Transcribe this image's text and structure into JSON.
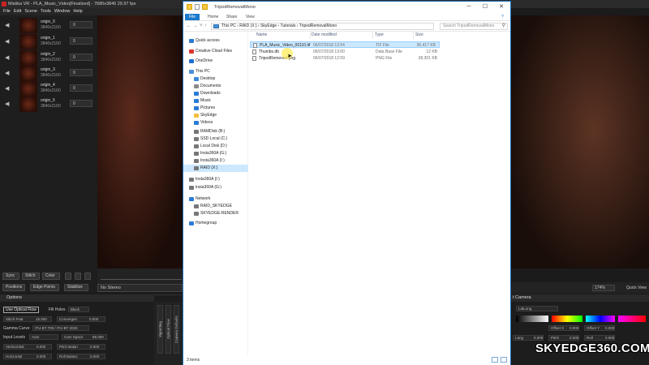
{
  "app": {
    "title": "Mistika VR - PLA_Music_Video[Finalized] - 7680x3840 29.97 fps",
    "menu": [
      "File",
      "Edit",
      "Scene",
      "Tools",
      "Window",
      "Help"
    ]
  },
  "clips": [
    {
      "name": "origin_0",
      "res": "3840x2160",
      "value": "0"
    },
    {
      "name": "origin_1",
      "res": "3840x2160",
      "value": "0"
    },
    {
      "name": "origin_2",
      "res": "3840x2160",
      "value": "0"
    },
    {
      "name": "origin_3",
      "res": "3840x2160",
      "value": "0"
    },
    {
      "name": "origin_4",
      "res": "3840x2160",
      "value": "0"
    },
    {
      "name": "origin_5",
      "res": "3840x2160",
      "value": "0"
    }
  ],
  "toolbar": {
    "sync": "Sync",
    "stitch": "Stitch",
    "color": "Color",
    "positions": "Positions",
    "edge_points": "Edge Points",
    "stabilize": "Stabilize",
    "no_stereo": "No Stereo",
    "zoom": "174%",
    "quick_view": "Quick View"
  },
  "options": {
    "title": "Options",
    "use_optical_flow": "Use Optical Flow",
    "fill_holes_label": "Fill Holes",
    "fill_holes_value": "Black",
    "stitch_feather_label": "Stitch Feat",
    "stitch_feather_value": "15.000",
    "convergence_label": "Convergen",
    "convergence_value": "0.000",
    "gamma_label": "Gamma Curve",
    "gamma_value": "ITU-BT 709 / ITU-BT 2020",
    "input_levels_label": "Input Levels",
    "input_levels_value": "Auto",
    "cam_spacing_label": "Cam Spacir",
    "cam_spacing_value": "65.000",
    "vertical_bal_label": "Vertical Bal",
    "vertical_bal_value": "0.000",
    "pitch_balance_label": "Pitch Balan",
    "pitch_balance_value": "0.000",
    "horizontal_label": "Horizontal",
    "horizontal_value": "0.000",
    "roll_balance_label": "Roll Balanc",
    "roll_balance_value": "0.000",
    "vtabs": [
      "Vignetting",
      "Optical Flow",
      "Camera Defaults"
    ]
  },
  "camera": {
    "title": "t Camera",
    "projection": "LatLong",
    "fields": [
      {
        "label": "Lang",
        "value": "0.000"
      },
      {
        "label": "Pitch",
        "value": "0.000"
      },
      {
        "label": "Roll",
        "value": "0.000"
      },
      {
        "label": "Offset X",
        "value": "0.000"
      },
      {
        "label": "Offset Y",
        "value": "0.000"
      }
    ]
  },
  "watermark": "SKYEDGE360.COM",
  "explorer": {
    "title": "TripodRemovalMono",
    "ribbon": {
      "file": "File",
      "home": "Home",
      "share": "Share",
      "view": "View"
    },
    "path": [
      "This PC",
      "RAID (X:)",
      "SkyEdge",
      "Tutorials",
      "TripodRemovalMono"
    ],
    "search_placeholder": "Search TripodRemovalMono",
    "nav": [
      {
        "label": "Quick access",
        "color": "#2b7bd6",
        "indent": 0
      },
      {
        "label": "Creative Cloud Files",
        "color": "#d9362b",
        "indent": 0
      },
      {
        "label": "OneDrive",
        "color": "#1c6fd0",
        "indent": 0
      },
      {
        "label": "This PC",
        "color": "#4a90d9",
        "indent": 0
      },
      {
        "label": "Desktop",
        "color": "#3b8ad8",
        "indent": 1
      },
      {
        "label": "Documents",
        "color": "#8a8a8a",
        "indent": 1
      },
      {
        "label": "Downloads",
        "color": "#2b7bd6",
        "indent": 1
      },
      {
        "label": "Music",
        "color": "#2b7bd6",
        "indent": 1
      },
      {
        "label": "Pictures",
        "color": "#2b7bd6",
        "indent": 1
      },
      {
        "label": "SkyEdge",
        "color": "#f0c040",
        "indent": 1
      },
      {
        "label": "Videos",
        "color": "#2b7bd6",
        "indent": 1
      },
      {
        "label": "RAMDisk (B:)",
        "color": "#777",
        "indent": 1
      },
      {
        "label": "SSD Local (C:)",
        "color": "#777",
        "indent": 1
      },
      {
        "label": "Local Disk (D:)",
        "color": "#777",
        "indent": 1
      },
      {
        "label": "Insta360A (G:)",
        "color": "#777",
        "indent": 1
      },
      {
        "label": "Insta360A (I:)",
        "color": "#777",
        "indent": 1
      },
      {
        "label": "RAID (X:)",
        "color": "#777",
        "indent": 1
      },
      {
        "label": "Insta360A (I:)",
        "color": "#777",
        "indent": 0
      },
      {
        "label": "insta360A (G:)",
        "color": "#777",
        "indent": 0
      },
      {
        "label": "Network",
        "color": "#2b7bd6",
        "indent": 0
      },
      {
        "label": "RAID_SKYEDGE",
        "color": "#777",
        "indent": 1
      },
      {
        "label": "SKYEDGE-RENDER",
        "color": "#777",
        "indent": 1
      },
      {
        "label": "Homegroup",
        "color": "#2b7bd6",
        "indent": 0
      }
    ],
    "columns": {
      "name": "Name",
      "date": "Date modified",
      "type": "Type",
      "size": "Size"
    },
    "files": [
      {
        "name": "PLA_Music_Video_00110.tif",
        "date": "06/07/2018 12:54",
        "type": "TIF File",
        "size": "96,417 KB"
      },
      {
        "name": "Thumbs.db",
        "date": "06/07/2018 13:00",
        "type": "Data Base File",
        "size": "12 KB"
      },
      {
        "name": "TripodRemoved.png",
        "date": "06/07/2018 12:59",
        "type": "PNG File",
        "size": "28,301 KB"
      }
    ],
    "status": "3 items"
  }
}
